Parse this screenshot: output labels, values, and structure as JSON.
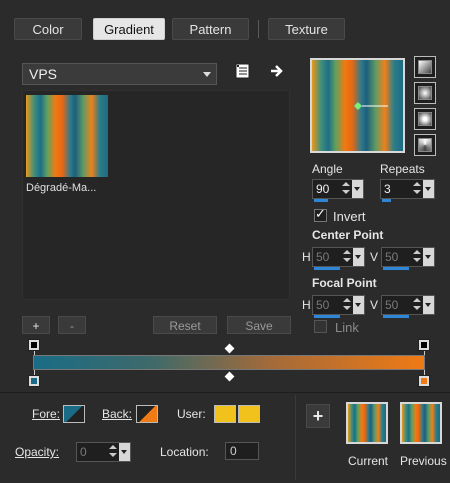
{
  "tabs": [
    {
      "label": "Color"
    },
    {
      "label": "Gradient",
      "active": true
    },
    {
      "label": "Pattern"
    },
    {
      "label": "Texture"
    }
  ],
  "collection": {
    "selected": "VPS"
  },
  "gallery": {
    "items": [
      {
        "label": "Dégradé-Ma..."
      }
    ]
  },
  "list_buttons": {
    "add": "+",
    "remove": "-",
    "reset": "Reset",
    "save": "Save"
  },
  "angle": {
    "label": "Angle",
    "value": "90"
  },
  "repeats": {
    "label": "Repeats",
    "value": "3"
  },
  "invert": {
    "label": "Invert",
    "checked": true
  },
  "center_point": {
    "label": "Center Point",
    "h_label": "H",
    "h_value": "50",
    "v_label": "V",
    "v_value": "50"
  },
  "focal_point": {
    "label": "Focal Point",
    "h_label": "H",
    "h_value": "50",
    "v_label": "V",
    "v_value": "50"
  },
  "link": {
    "label": "Link",
    "checked": false
  },
  "colors": {
    "fore": "#1a6c86",
    "back": "#f07a14",
    "user1": "#f2c21c",
    "user2": "#f2c21c"
  },
  "bottom": {
    "fore_label": "Fore:",
    "back_label": "Back:",
    "user_label": "User:",
    "opacity_label": "Opacity:",
    "opacity_value": "0",
    "location_label": "Location:",
    "location_value": "0",
    "add_icon_label": "+",
    "current_label": "Current",
    "previous_label": "Previous"
  }
}
